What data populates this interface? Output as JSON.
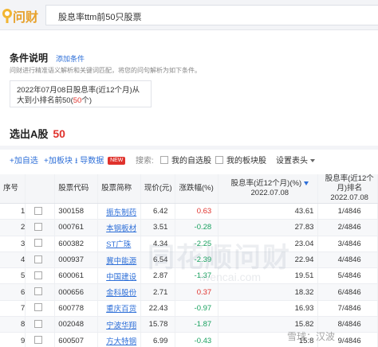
{
  "app": {
    "logo_text": "问财"
  },
  "search": {
    "query": "股息率ttm前50只股票"
  },
  "conditions": {
    "title": "条件说明",
    "add_label": "添加条件",
    "description": "问财进行精准语义解析和关键词匹配，将您的问句解析为如下条件。",
    "box_text": "2022年07月08日股息率(近12个月)从大到小排名前50(",
    "box_num": "50",
    "box_suffix": "个)"
  },
  "result": {
    "label": "选出A股",
    "count": "50"
  },
  "toolbar": {
    "add_watch": "+加自选",
    "add_block": "+加板块",
    "export": "导数据",
    "new_badge": "NEW",
    "search_label": "搜索:",
    "my_watch": "我的自选股",
    "my_block": "我的板块股",
    "settings": "设置表头"
  },
  "table": {
    "headers": {
      "idx": "序号",
      "code": "股票代码",
      "name": "股票简称",
      "price": "现价(元)",
      "change": "涨跌幅(%)",
      "eps1": "股息率(近12个月)(%)",
      "eps2": "2022.07.08",
      "rank1": "股息率(近12个月)排名",
      "rank2": "2022.07.08"
    },
    "rows": [
      {
        "idx": "1",
        "code": "300158",
        "name": "振东制药",
        "price": "6.42",
        "change": "0.63",
        "dir": "up",
        "eps": "43.61",
        "rank": "1/4846"
      },
      {
        "idx": "2",
        "code": "000761",
        "name": "本钢板材",
        "price": "3.51",
        "change": "-0.28",
        "dir": "down",
        "eps": "27.83",
        "rank": "2/4846"
      },
      {
        "idx": "3",
        "code": "600382",
        "name": "ST广珠",
        "price": "4.34",
        "change": "-2.25",
        "dir": "down",
        "eps": "23.04",
        "rank": "3/4846"
      },
      {
        "idx": "4",
        "code": "000937",
        "name": "冀中能源",
        "price": "6.54",
        "change": "-2.39",
        "dir": "down",
        "eps": "22.94",
        "rank": "4/4846"
      },
      {
        "idx": "5",
        "code": "600061",
        "name": "中国建设",
        "price": "2.87",
        "change": "-1.37",
        "dir": "down",
        "eps": "19.51",
        "rank": "5/4846"
      },
      {
        "idx": "6",
        "code": "000656",
        "name": "金科股份",
        "price": "2.71",
        "change": "0.37",
        "dir": "up",
        "eps": "18.32",
        "rank": "6/4846"
      },
      {
        "idx": "7",
        "code": "600778",
        "name": "重庆百货",
        "price": "22.43",
        "change": "-0.97",
        "dir": "down",
        "eps": "16.93",
        "rank": "7/4846"
      },
      {
        "idx": "8",
        "code": "002048",
        "name": "宁波华翔",
        "price": "15.78",
        "change": "-1.87",
        "dir": "down",
        "eps": "15.82",
        "rank": "8/4846"
      },
      {
        "idx": "9",
        "code": "600507",
        "name": "方大特钢",
        "price": "6.99",
        "change": "-0.43",
        "dir": "down",
        "eps": "15.8",
        "rank": "9/4846"
      }
    ]
  },
  "watermark": {
    "main": "同花顺问财",
    "sub": "iwencai.com",
    "corner": "雪球：汉波"
  },
  "colors": {
    "accent": "#2e6fd8",
    "up": "#e0322c",
    "down": "#19a15f",
    "logo": "#e7a12b"
  }
}
